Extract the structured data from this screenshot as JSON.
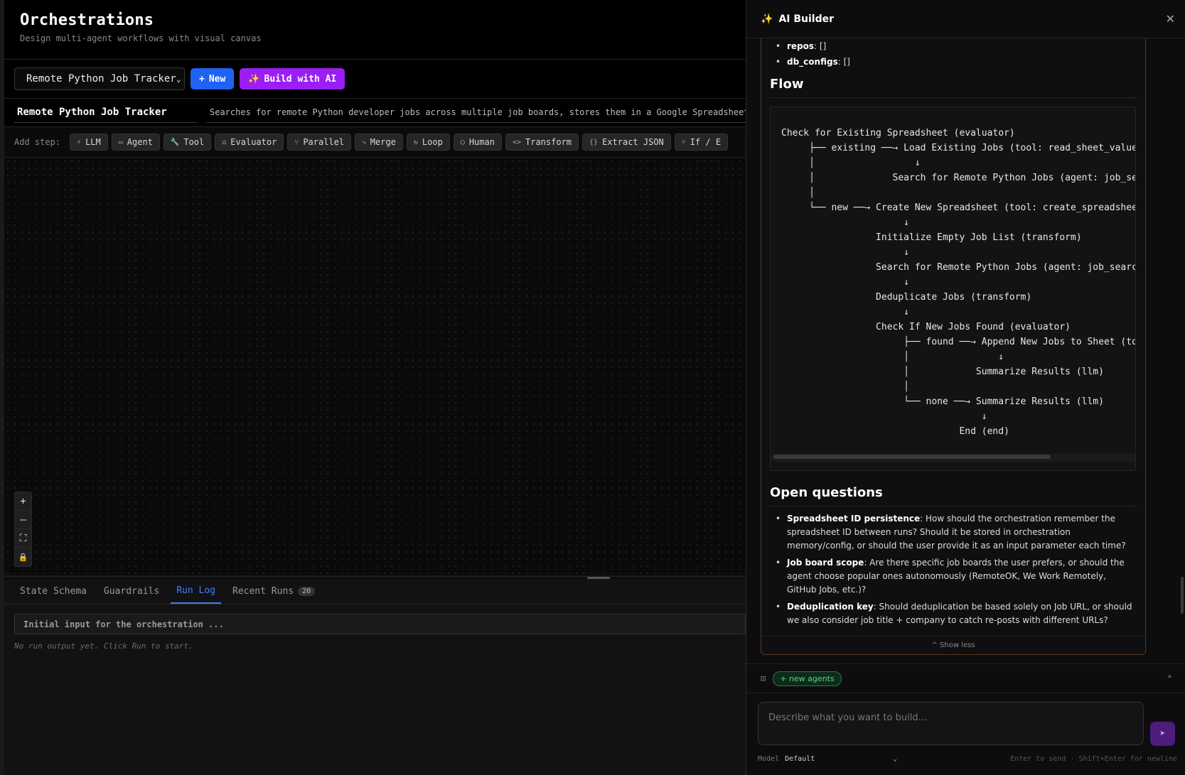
{
  "header": {
    "title": "Orchestrations",
    "subtitle": "Design multi-agent workflows with visual canvas"
  },
  "toolbar": {
    "selected_orchestration": "Remote Python Job Tracker",
    "new_label": "New",
    "build_ai_label": "Build with AI"
  },
  "details": {
    "name": "Remote Python Job Tracker",
    "description": "Searches for remote Python developer jobs across multiple job boards, stores them in a Google Spreadsheet"
  },
  "steps": {
    "label": "Add step:",
    "items": [
      {
        "label": "LLM",
        "icon": "⚡"
      },
      {
        "label": "Agent",
        "icon": "▭"
      },
      {
        "label": "Tool",
        "icon": "🔧"
      },
      {
        "label": "Evaluator",
        "icon": "⚖"
      },
      {
        "label": "Parallel",
        "icon": "⑂"
      },
      {
        "label": "Merge",
        "icon": "⤷"
      },
      {
        "label": "Loop",
        "icon": "↻"
      },
      {
        "label": "Human",
        "icon": "◯"
      },
      {
        "label": "Transform",
        "icon": "<>"
      },
      {
        "label": "Extract JSON",
        "icon": "{}"
      },
      {
        "label": "If / E",
        "icon": "⑂"
      }
    ]
  },
  "zoom_controls": {
    "zoom_in": "+",
    "zoom_out": "—",
    "fit": "⛶",
    "lock": "🔒"
  },
  "bottom": {
    "tabs": [
      {
        "label": "State Schema"
      },
      {
        "label": "Guardrails"
      },
      {
        "label": "Run Log",
        "active": true
      },
      {
        "label": "Recent Runs",
        "badge": "20"
      }
    ],
    "run_input_placeholder": "Initial input for the orchestration ...",
    "run_output": "No run output yet. Click Run to start."
  },
  "panel": {
    "title": "AI Builder",
    "close": "✕",
    "top_bullets": [
      {
        "key": "repos",
        "value": ": []"
      },
      {
        "key": "db_configs",
        "value": ": []"
      }
    ],
    "flow_heading": "Flow",
    "flow_text": "Check for Existing Spreadsheet (evaluator)\n     ├── existing ──→ Load Existing Jobs (tool: read_sheet_values\n     │                  ↓\n     │              Search for Remote Python Jobs (agent: job_sea\n     │\n     └── new ──→ Create New Spreadsheet (tool: create_spreadsheet\n                      ↓\n                 Initialize Empty Job List (transform)\n                      ↓\n                 Search for Remote Python Jobs (agent: job_search_ag\n                      ↓\n                 Deduplicate Jobs (transform)\n                      ↓\n                 Check If New Jobs Found (evaluator)\n                      ├── found ──→ Append New Jobs to Sheet (tool: a\n                      │                ↓\n                      │            Summarize Results (llm)\n                      │\n                      └── none ──→ Summarize Results (llm)\n                                    ↓\n                                End (end)",
    "open_questions_heading": "Open questions",
    "open_questions": [
      {
        "key": "Spreadsheet ID persistence",
        "text": ": How should the orchestration remember the spreadsheet ID between runs? Should it be stored in orchestration memory/config, or should the user provide it as an input parameter each time?"
      },
      {
        "key": "Job board scope",
        "text": ": Are there specific job boards the user prefers, or should the agent choose popular ones autonomously (RemoteOK, We Work Remotely, GitHub Jobs, etc.)?"
      },
      {
        "key": "Deduplication key",
        "text": ": Should deduplication be based solely on Job URL, or should we also consider job title + company to catch re-posts with different URLs?"
      }
    ],
    "show_less": "^ Show less",
    "new_agents_label": "+ new agents",
    "chat_placeholder": "Describe what you want to build…",
    "model_label": "Model",
    "model_value": "Default",
    "send_hint": "Enter to send · Shift+Enter for newline"
  },
  "colors": {
    "accent_blue": "#1f63f5",
    "accent_purple": "#9b1ef5",
    "active_tab": "#3b82f6",
    "agent_pill_green": "#4ade80"
  }
}
